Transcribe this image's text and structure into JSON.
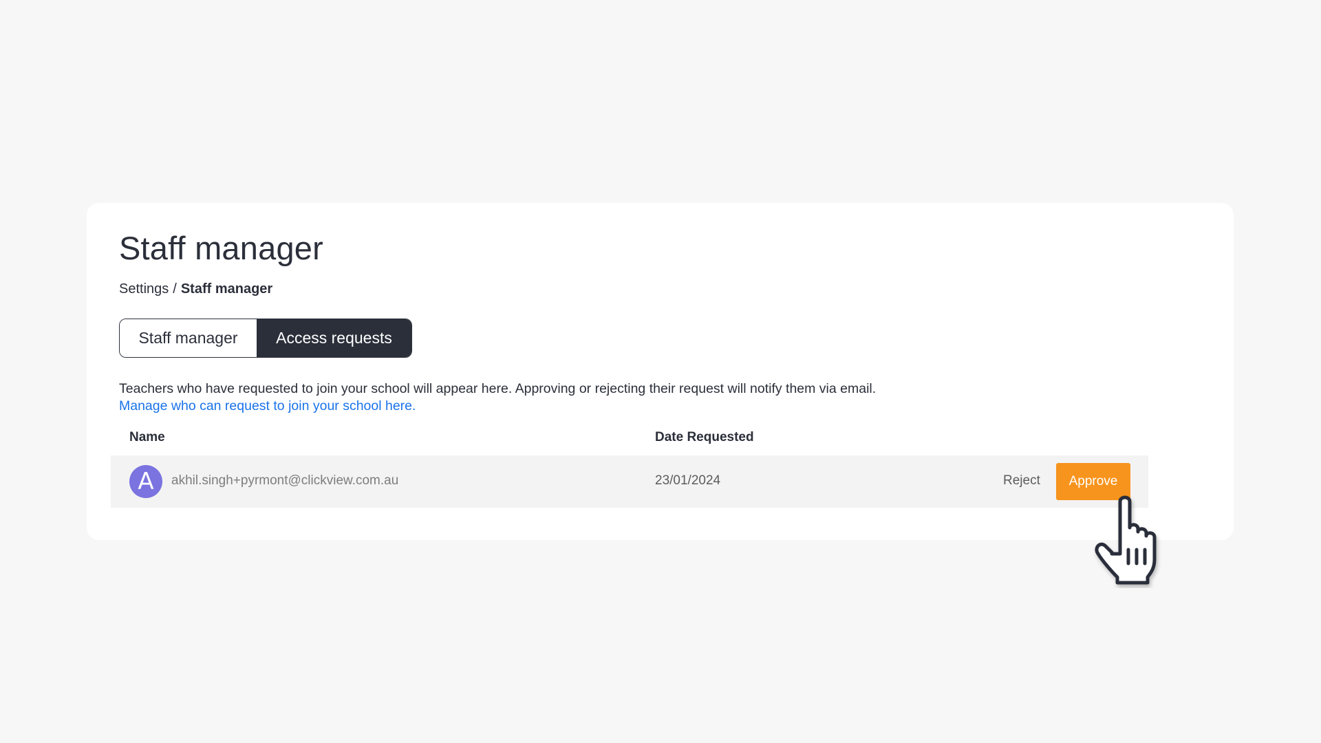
{
  "page": {
    "title": "Staff manager",
    "breadcrumb": {
      "parent": "Settings",
      "separator": "/",
      "current": "Staff manager"
    }
  },
  "tabs": [
    {
      "label": "Staff manager",
      "active": false
    },
    {
      "label": "Access requests",
      "active": true
    }
  ],
  "description": {
    "text": "Teachers who have requested to join your school will appear here. Approving or rejecting their request will notify them via email.",
    "link": "Manage who can request to join your school here."
  },
  "table": {
    "columns": [
      "Name",
      "Date Requested"
    ],
    "rows": [
      {
        "avatar_initial": "A",
        "email": "akhil.singh+pyrmont@clickview.com.au",
        "date_requested": "23/01/2024",
        "reject_label": "Reject",
        "approve_label": "Approve"
      }
    ]
  },
  "icons": {
    "cursor": "hand-pointer-icon"
  },
  "colors": {
    "primary_dark": "#2b2f3a",
    "link": "#1a73e8",
    "approve": "#f7941d",
    "avatar": "#7a73e0",
    "page_background": "#f7f7f7"
  }
}
